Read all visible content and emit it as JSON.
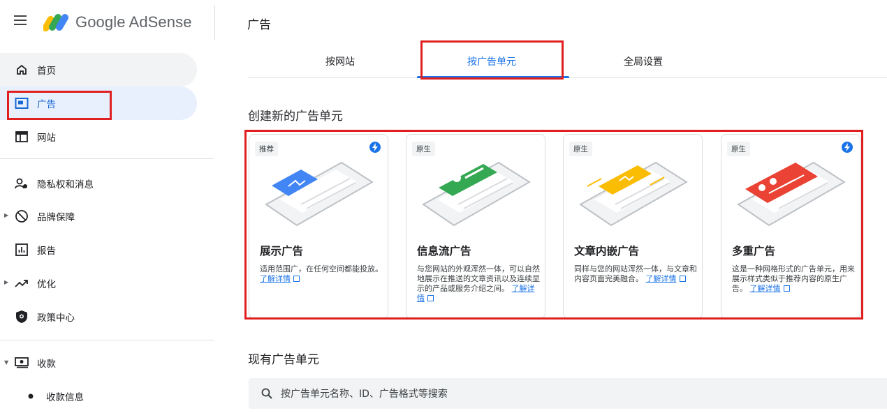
{
  "header": {
    "brand": "Google AdSense",
    "page_title": "广告"
  },
  "sidebar": {
    "items": [
      {
        "label": "首页",
        "icon": "home-icon"
      },
      {
        "label": "广告",
        "icon": "ads-icon"
      },
      {
        "label": "网站",
        "icon": "sites-icon"
      },
      {
        "label": "隐私权和消息",
        "icon": "privacy-icon"
      },
      {
        "label": "品牌保障",
        "icon": "block-icon"
      },
      {
        "label": "报告",
        "icon": "reports-icon"
      },
      {
        "label": "优化",
        "icon": "trend-icon"
      },
      {
        "label": "政策中心",
        "icon": "shield-icon"
      },
      {
        "label": "收款",
        "icon": "payments-icon"
      },
      {
        "label": "收款信息",
        "icon": "bullet-icon"
      }
    ],
    "active": "广告"
  },
  "tabs": [
    {
      "label": "按网站"
    },
    {
      "label": "按广告单元"
    },
    {
      "label": "全局设置"
    }
  ],
  "active_tab": "按广告单元",
  "create_heading": "创建新的广告单元",
  "cards": [
    {
      "badge": "推荐",
      "title": "展示广告",
      "desc": "适用范围广，在任何空间都能投放。",
      "learn": "了解详情",
      "color": "#4285f4"
    },
    {
      "badge": "原生",
      "title": "信息流广告",
      "desc": "与您网站的外观浑然一体，可以自然地展示在推送的文章资讯以及连续显示的产品或服务介绍之间。",
      "learn": "了解详情",
      "color": "#34a853"
    },
    {
      "badge": "原生",
      "title": "文章内嵌广告",
      "desc": "同样与您的网站浑然一体，与文章和内容页面完美融合。",
      "learn": "了解详情",
      "color": "#fbbc04"
    },
    {
      "badge": "原生",
      "title": "多重广告",
      "desc": "这是一种网格形式的广告单元，用来展示样式类似于推荐内容的原生广告。",
      "learn": "了解详情",
      "color": "#ea4335"
    }
  ],
  "existing_heading": "现有广告单元",
  "search": {
    "placeholder": "按广告单元名称、ID、广告格式等搜索"
  },
  "colors": {
    "accent": "#1a73e8",
    "highlight": "#e02020"
  }
}
